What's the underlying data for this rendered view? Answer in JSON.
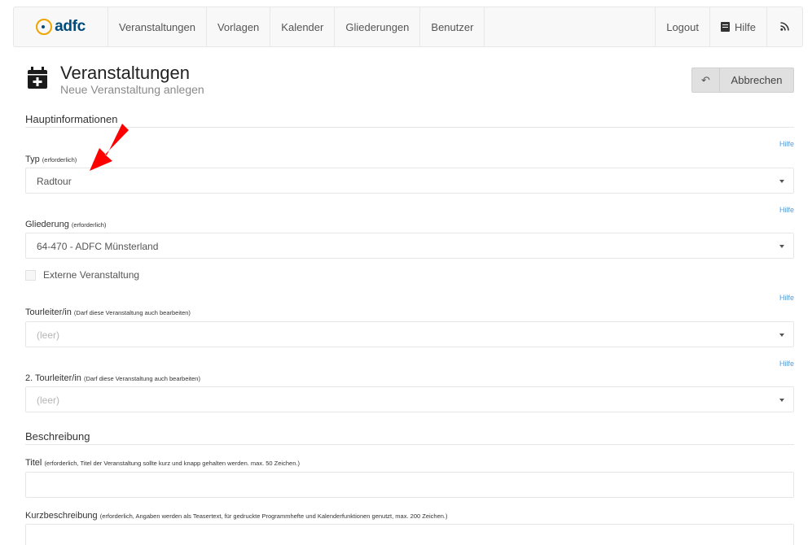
{
  "navbar": {
    "brand": "adfc",
    "items": [
      "Veranstaltungen",
      "Vorlagen",
      "Kalender",
      "Gliederungen",
      "Benutzer"
    ],
    "logout": "Logout",
    "help": "Hilfe",
    "icons": {
      "help": "book-icon",
      "feed": "rss-icon"
    }
  },
  "header": {
    "title": "Veranstaltungen",
    "subtitle": "Neue Veranstaltung anlegen",
    "cancel_label": "Abbrechen"
  },
  "sections": {
    "main_info": "Hauptinformationen",
    "description": "Beschreibung"
  },
  "fields": {
    "help_link": "Hilfe",
    "typ": {
      "label": "Typ",
      "hint": "(erforderlich)",
      "value": "Radtour"
    },
    "gliederung": {
      "label": "Gliederung",
      "hint": "(erforderlich)",
      "value": "64-470 - ADFC Münsterland"
    },
    "extern": {
      "label": "Externe Veranstaltung",
      "checked": false
    },
    "tourleiter": {
      "label": "Tourleiter/in",
      "hint": "(Darf diese Veranstaltung auch bearbeiten)",
      "placeholder": "(leer)"
    },
    "tourleiter2": {
      "label": "2. Tourleiter/in",
      "hint": "(Darf diese Veranstaltung auch bearbeiten)",
      "placeholder": "(leer)"
    },
    "titel": {
      "label": "Titel",
      "hint": "(erforderlich, Titel der Veranstaltung sollte kurz und knapp gehalten werden. max. 50 Zeichen.)",
      "value": ""
    },
    "kurzbeschreibung": {
      "label": "Kurzbeschreibung",
      "hint": "(erforderlich, Angaben werden als Teasertext, für gedruckte Programmhefte und Kalenderfunktionen genutzt, max. 200 Zeichen.)",
      "value": ""
    }
  },
  "colors": {
    "brand_blue": "#004b7c",
    "brand_orange": "#f0a400",
    "help_link": "#5b9bd5",
    "annotation_arrow": "#ff0000"
  }
}
